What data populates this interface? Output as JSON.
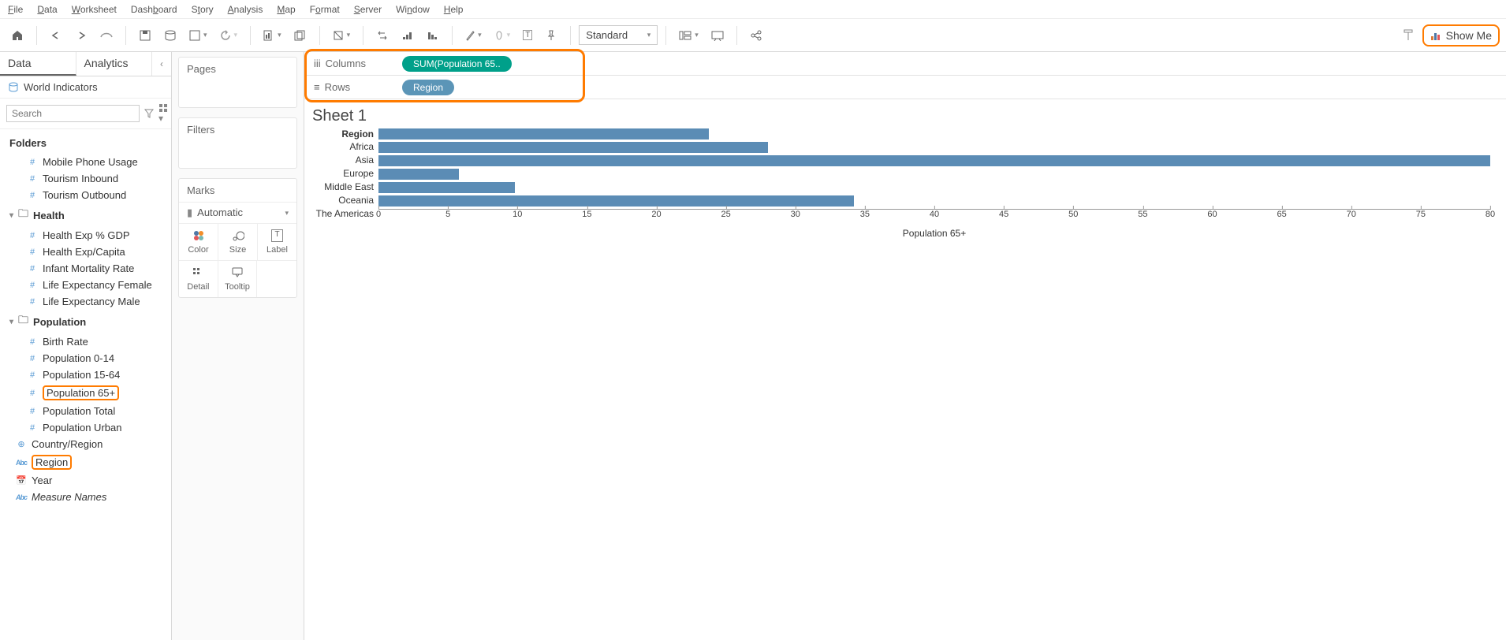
{
  "menu": {
    "file": "File",
    "data": "Data",
    "worksheet": "Worksheet",
    "dashboard": "Dashboard",
    "story": "Story",
    "analysis": "Analysis",
    "map": "Map",
    "format": "Format",
    "server": "Server",
    "window": "Window",
    "help": "Help"
  },
  "toolbar": {
    "fit_mode": "Standard",
    "showme": "Show Me"
  },
  "sidebar": {
    "tabs": {
      "data": "Data",
      "analytics": "Analytics"
    },
    "datasource": "World Indicators",
    "search_placeholder": "Search",
    "folders_label": "Folders",
    "folders": [
      {
        "label": "Mobile Phone Usage"
      },
      {
        "label": "Tourism Inbound"
      },
      {
        "label": "Tourism Outbound"
      }
    ],
    "groups": [
      {
        "name": "Health",
        "items": [
          {
            "label": "Health Exp % GDP",
            "type": "num"
          },
          {
            "label": "Health Exp/Capita",
            "type": "num"
          },
          {
            "label": "Infant Mortality Rate",
            "type": "num"
          },
          {
            "label": "Life Expectancy Female",
            "type": "num"
          },
          {
            "label": "Life Expectancy Male",
            "type": "num"
          }
        ]
      },
      {
        "name": "Population",
        "items": [
          {
            "label": "Birth Rate",
            "type": "num"
          },
          {
            "label": "Population 0-14",
            "type": "num"
          },
          {
            "label": "Population 15-64",
            "type": "num"
          },
          {
            "label": "Population 65+",
            "type": "num",
            "highlight": true
          },
          {
            "label": "Population Total",
            "type": "num"
          },
          {
            "label": "Population Urban",
            "type": "num"
          }
        ]
      }
    ],
    "loose_items": [
      {
        "label": "Country/Region",
        "type": "globe"
      },
      {
        "label": "Region",
        "type": "abc",
        "highlight": true
      },
      {
        "label": "Year",
        "type": "date"
      },
      {
        "label": "Measure Names",
        "type": "abc",
        "italic": true
      }
    ]
  },
  "cards": {
    "pages": "Pages",
    "filters": "Filters",
    "marks": "Marks",
    "mark_type": "Automatic",
    "color": "Color",
    "size": "Size",
    "label": "Label",
    "detail": "Detail",
    "tooltip": "Tooltip"
  },
  "shelves": {
    "columns_label": "Columns",
    "rows_label": "Rows",
    "columns_pill": "SUM(Population 65..",
    "rows_pill": "Region"
  },
  "viz": {
    "title": "Sheet 1",
    "yheader": "Region",
    "xlabel": "Population 65+"
  },
  "chart_data": {
    "type": "bar",
    "orientation": "horizontal",
    "categories": [
      "Africa",
      "Asia",
      "Europe",
      "Middle East",
      "Oceania",
      "The Americas"
    ],
    "values": [
      23.8,
      28.0,
      80.0,
      5.8,
      9.8,
      34.2
    ],
    "xlabel": "Population 65+",
    "ylabel": "Region",
    "xlim": [
      0,
      80
    ],
    "xticks": [
      0,
      5,
      10,
      15,
      20,
      25,
      30,
      35,
      40,
      45,
      50,
      55,
      60,
      65,
      70,
      75,
      80
    ]
  }
}
